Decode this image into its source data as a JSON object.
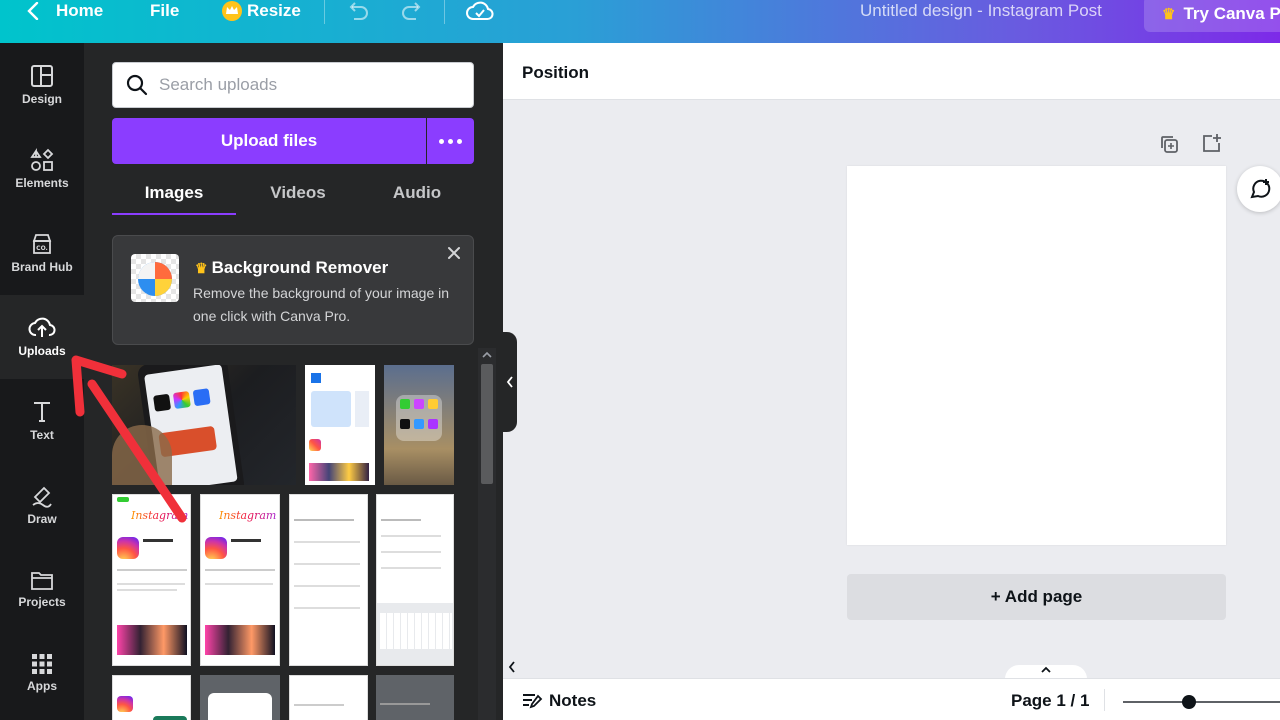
{
  "topbar": {
    "home": "Home",
    "file": "File",
    "resize": "Resize",
    "title": "Untitled design - Instagram Post",
    "try_pro": "Try Canva Pr"
  },
  "rail": {
    "items": [
      {
        "label": "Design",
        "icon": "layout-icon"
      },
      {
        "label": "Elements",
        "icon": "shapes-icon"
      },
      {
        "label": "Brand Hub",
        "icon": "brand-icon"
      },
      {
        "label": "Uploads",
        "icon": "cloud-upload-icon",
        "active": true
      },
      {
        "label": "Text",
        "icon": "text-icon"
      },
      {
        "label": "Draw",
        "icon": "pen-icon"
      },
      {
        "label": "Projects",
        "icon": "folder-icon"
      },
      {
        "label": "Apps",
        "icon": "grid-icon"
      }
    ]
  },
  "panel": {
    "search_placeholder": "Search uploads",
    "upload_label": "Upload files",
    "tabs": [
      "Images",
      "Videos",
      "Audio"
    ],
    "active_tab": "Images",
    "promo": {
      "title": "Background Remover",
      "desc": "Remove the background of your image in one click with Canva Pro."
    },
    "thumb_texts": {
      "instagram": "Instagram"
    }
  },
  "editor": {
    "position_label": "Position",
    "add_page": "+ Add page",
    "notes": "Notes",
    "page_indicator": "Page 1 / 1"
  },
  "colors": {
    "accent": "#8b3dff",
    "rail_bg": "#18191b",
    "panel_bg": "#252627",
    "arrow": "#f0303a"
  }
}
